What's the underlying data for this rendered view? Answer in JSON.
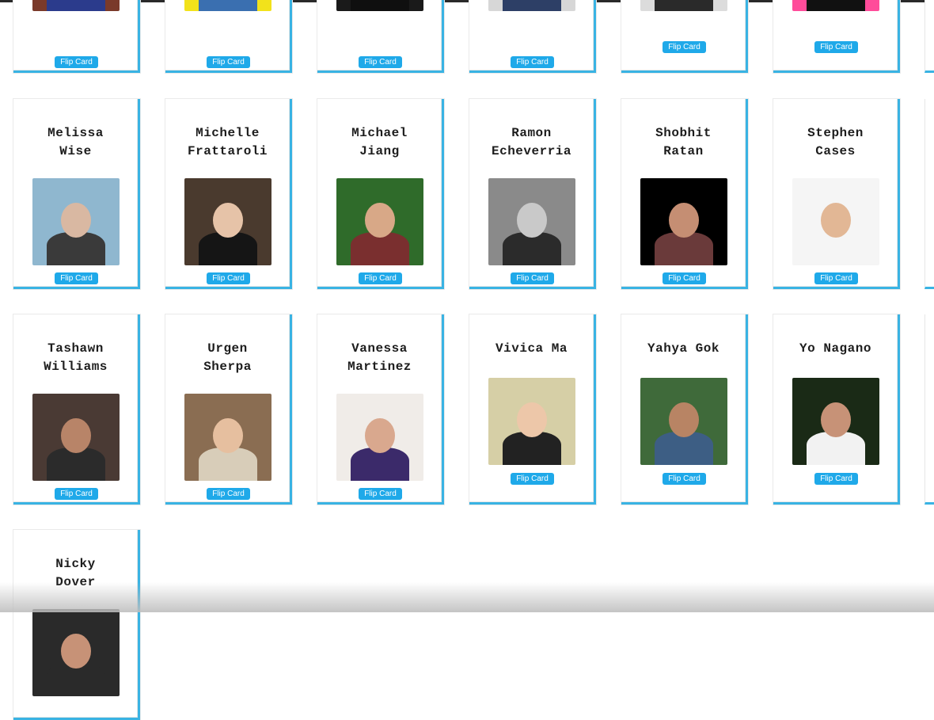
{
  "button_label": "Flip Card",
  "rows": [
    {
      "cards": [
        {
          "name": [
            "",
            ""
          ],
          "photo": "partial-photo"
        },
        {
          "name": [
            "",
            ""
          ],
          "photo": "partial-photo"
        },
        {
          "name": [
            "",
            ""
          ],
          "photo": "partial-photo"
        },
        {
          "name": [
            "",
            ""
          ],
          "photo": "partial-photo"
        },
        {
          "name": [
            "",
            ""
          ],
          "photo": "partial-photo"
        },
        {
          "name": [
            "",
            ""
          ],
          "photo": "partial-photo"
        }
      ]
    },
    {
      "cards": [
        {
          "name": [
            "Melissa",
            "Wise"
          ]
        },
        {
          "name": [
            "Michelle",
            "Frattaroli"
          ]
        },
        {
          "name": [
            "Michael",
            "Jiang"
          ]
        },
        {
          "name": [
            "Ramon",
            "Echeverria"
          ]
        },
        {
          "name": [
            "Shobhit",
            "Ratan"
          ]
        },
        {
          "name": [
            "Stephen",
            "Cases"
          ]
        }
      ]
    },
    {
      "cards": [
        {
          "name": [
            "Tashawn",
            "Williams"
          ]
        },
        {
          "name": [
            "Urgen",
            "Sherpa"
          ]
        },
        {
          "name": [
            "Vanessa",
            "Martinez"
          ]
        },
        {
          "name": [
            "Vivica Ma",
            ""
          ]
        },
        {
          "name": [
            "Yahya Gok",
            ""
          ]
        },
        {
          "name": [
            "Yo Nagano",
            ""
          ]
        }
      ]
    },
    {
      "cards": [
        {
          "name": [
            "Nicky",
            "Dover"
          ]
        }
      ]
    }
  ],
  "colors": {
    "accent_border": "#39b3e3",
    "button_bg": "#1fa9e9",
    "button_text": "#ffffff",
    "name_text": "#1d1d1d"
  }
}
